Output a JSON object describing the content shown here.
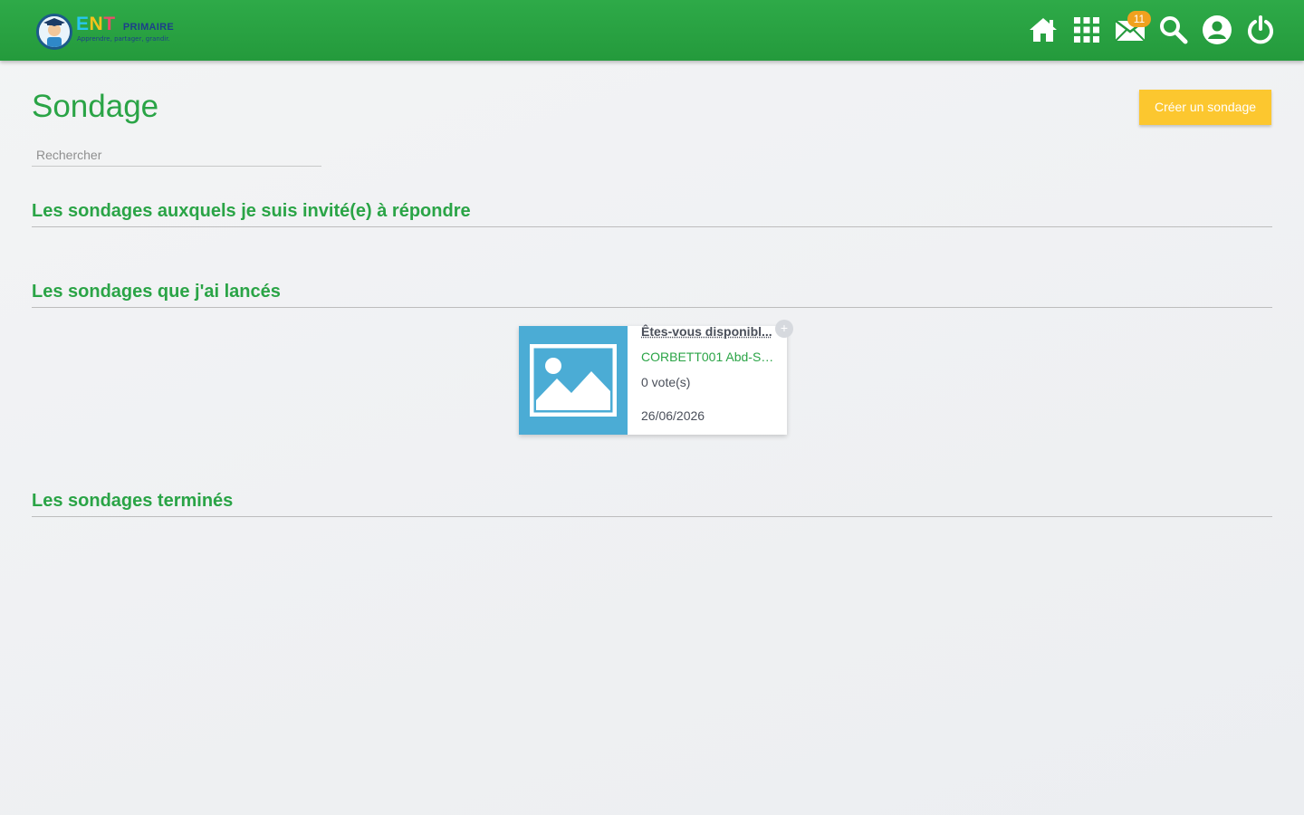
{
  "header": {
    "logo": {
      "brand_letters": [
        "E",
        "N",
        "T"
      ],
      "brand_suffix": "PRIMAIRE",
      "tagline": "Apprendre, partager, grandir."
    },
    "nav": [
      {
        "name": "home",
        "icon": "home-icon"
      },
      {
        "name": "apps",
        "icon": "grid-icon"
      },
      {
        "name": "messages",
        "icon": "mail-icon",
        "badge": "11"
      },
      {
        "name": "search",
        "icon": "search-icon"
      },
      {
        "name": "account",
        "icon": "user-icon"
      },
      {
        "name": "logout",
        "icon": "power-icon"
      }
    ],
    "colors": {
      "bar": "#2aa446",
      "badge": "#f0a11f"
    }
  },
  "page": {
    "title": "Sondage",
    "create_button": "Créer un sondage",
    "search_placeholder": "Rechercher"
  },
  "sections": {
    "invited": {
      "title": "Les sondages auxquels je suis invité(e) à répondre",
      "items": []
    },
    "launched": {
      "title": "Les sondages que j'ai lancés",
      "items": [
        {
          "title": "Êtes-vous disponibl...",
          "author": "CORBETT001 Abd-Sa...",
          "votes": "0 vote(s)",
          "date": "26/06/2026",
          "thumbnail_icon": "image-placeholder-icon",
          "action_icon": "plus-icon"
        }
      ]
    },
    "finished": {
      "title": "Les sondages terminés",
      "items": []
    }
  },
  "colors": {
    "accent": "#2aa446",
    "button": "#fcc72f",
    "thumbnail": "#4bacd5"
  }
}
